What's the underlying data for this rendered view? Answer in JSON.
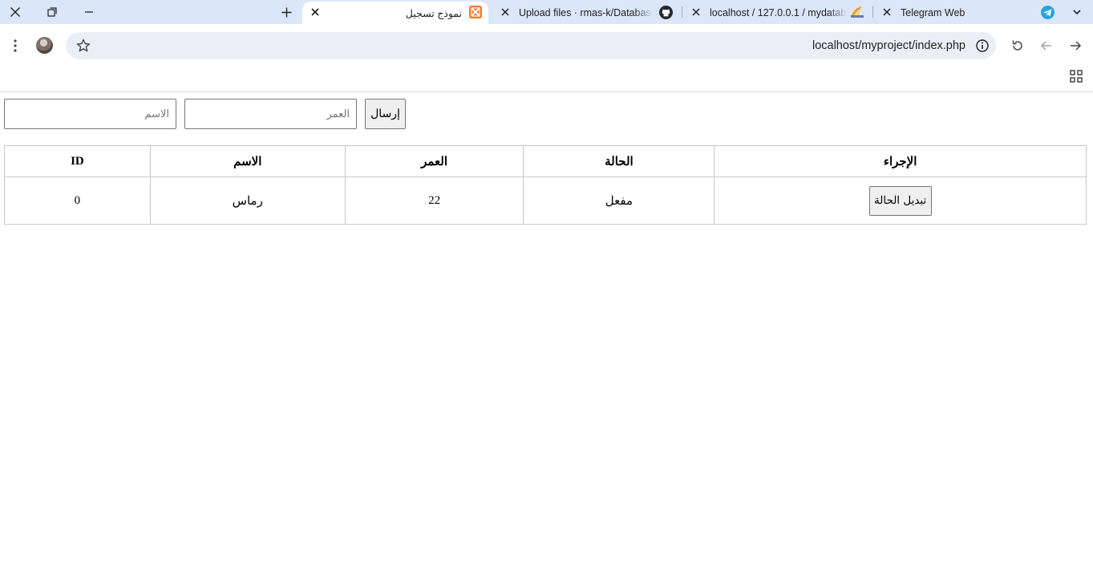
{
  "browser": {
    "tabs": [
      {
        "title": "Telegram Web",
        "active": false
      },
      {
        "title": "localhost / 127.0.0.1 / mydatabase",
        "active": false
      },
      {
        "title": "Upload files · rmas-k/Database",
        "active": false
      },
      {
        "title": "نموذج تسجيل",
        "active": true
      }
    ],
    "url": "localhost/myproject/index.php"
  },
  "form": {
    "name_placeholder": "الاسم",
    "age_placeholder": "العمر",
    "submit_label": "إرسال"
  },
  "table": {
    "headers": [
      "ID",
      "الاسم",
      "العمر",
      "الحالة",
      "الإجراء"
    ],
    "rows": [
      {
        "id": "0",
        "name": "رماس",
        "age": "22",
        "status": "مفعل",
        "action_label": "تبديل الحالة"
      }
    ]
  }
}
